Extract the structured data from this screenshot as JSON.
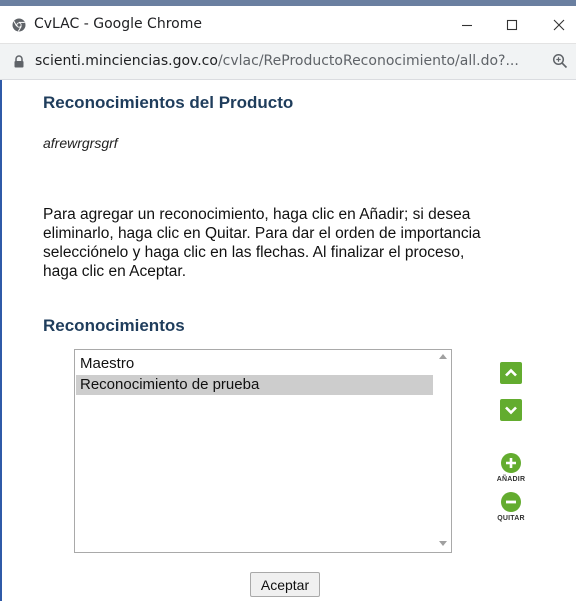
{
  "browser": {
    "window_title": "CvLAC - Google Chrome",
    "url_host": "scienti.minciencias.gov.co",
    "url_path": "/cvlac/ReProductoReconocimiento/all.do?...",
    "controls": {
      "minimize": "minimize-icon",
      "maximize": "maximize-icon",
      "close": "close-icon"
    }
  },
  "page": {
    "heading": "Reconocimientos del Producto",
    "product_name": "afrewrgrsgrf",
    "instructions": "Para agregar un reconocimiento, haga clic en Añadir; si desea eliminarlo, haga clic en Quitar. Para dar el orden de importancia selecciónelo y haga clic en las flechas. Al finalizar el proceso, haga clic en Aceptar.",
    "section_heading": "Reconocimientos",
    "list": {
      "items": [
        {
          "label": "Maestro",
          "selected": false
        },
        {
          "label": "Reconocimiento de prueba",
          "selected": true
        }
      ]
    },
    "actions": {
      "move_up_icon": "chevron-up-icon",
      "move_down_icon": "chevron-down-icon",
      "add_label": "AÑADIR",
      "remove_label": "QUITAR",
      "accept_label": "Aceptar"
    }
  },
  "colors": {
    "heading": "#1f3d5c",
    "action_green": "#63ac2f",
    "selected_row": "#cdcdcd",
    "window_border": "#2f5aa8"
  }
}
